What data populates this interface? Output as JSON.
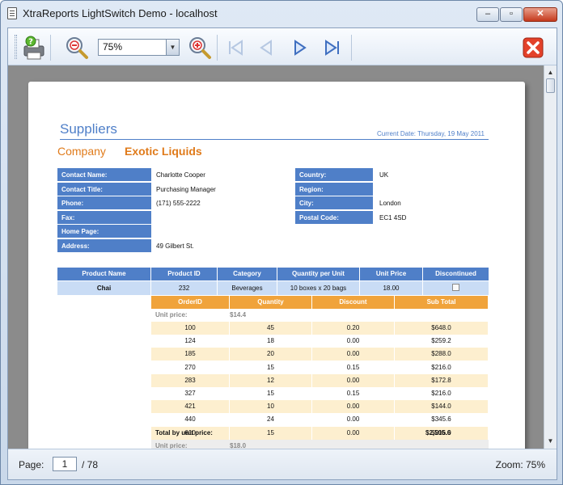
{
  "window": {
    "title": "XtraReports LightSwitch Demo - localhost"
  },
  "toolbar": {
    "zoom": "75%"
  },
  "report": {
    "title": "Suppliers",
    "current_date_label": "Current Date:",
    "current_date": "Thursday, 19 May 2011",
    "company_label": "Company",
    "company_name": "Exotic Liquids",
    "left_fields": [
      {
        "label": "Contact Name:",
        "value": "Charlotte Cooper"
      },
      {
        "label": "Contact Title:",
        "value": "Purchasing Manager"
      },
      {
        "label": "Phone:",
        "value": "(171) 555-2222"
      },
      {
        "label": "Fax:",
        "value": ""
      },
      {
        "label": "Home Page:",
        "value": ""
      },
      {
        "label": "Address:",
        "value": "49 Gilbert St."
      }
    ],
    "right_fields": [
      {
        "label": "Country:",
        "value": "UK"
      },
      {
        "label": "Region:",
        "value": ""
      },
      {
        "label": "City:",
        "value": "London"
      },
      {
        "label": "Postal Code:",
        "value": "EC1 4SD"
      }
    ],
    "product_headers": [
      "Product Name",
      "Product ID",
      "Category",
      "Quantity per Unit",
      "Unit Price",
      "Discontinued"
    ],
    "product_row": {
      "name": "Chai",
      "id": "232",
      "category": "Beverages",
      "quantity_per_unit": "10 boxes x 20 bags",
      "unit_price": "18.00",
      "discontinued": false
    },
    "order_headers": [
      "OrderID",
      "Quantity",
      "Discount",
      "Sub Total"
    ],
    "unit_price_label": "Unit price:",
    "unit_price_value": "$14.4",
    "orders": [
      {
        "order_id": "100",
        "quantity": "45",
        "discount": "0.20",
        "sub_total": "$648.0"
      },
      {
        "order_id": "124",
        "quantity": "18",
        "discount": "0.00",
        "sub_total": "$259.2"
      },
      {
        "order_id": "185",
        "quantity": "20",
        "discount": "0.00",
        "sub_total": "$288.0"
      },
      {
        "order_id": "270",
        "quantity": "15",
        "discount": "0.15",
        "sub_total": "$216.0"
      },
      {
        "order_id": "283",
        "quantity": "12",
        "discount": "0.00",
        "sub_total": "$172.8"
      },
      {
        "order_id": "327",
        "quantity": "15",
        "discount": "0.15",
        "sub_total": "$216.0"
      },
      {
        "order_id": "421",
        "quantity": "10",
        "discount": "0.00",
        "sub_total": "$144.0"
      },
      {
        "order_id": "440",
        "quantity": "24",
        "discount": "0.00",
        "sub_total": "$345.6"
      },
      {
        "order_id": "610",
        "quantity": "15",
        "discount": "0.00",
        "sub_total": "$216.0"
      }
    ],
    "total_label": "Total by unit price:",
    "total_value": "$2,505.6",
    "next_unit_price_label": "Unit price:",
    "next_unit_price_value": "$18.0"
  },
  "status": {
    "page_label": "Page:",
    "page_current": "1",
    "page_total": "/ 78",
    "zoom_label": "Zoom: 75%"
  },
  "colors": {
    "report_blue": "#4f7fc8",
    "orange": "#f0a33b",
    "row_alt": "#fdefcf",
    "product_row_bg": "#c9dcf5"
  },
  "icons": [
    "print-icon",
    "zoom-out-icon",
    "zoom-in-icon",
    "first-page-icon",
    "previous-page-icon",
    "next-page-icon",
    "last-page-icon",
    "close-preview-icon"
  ]
}
